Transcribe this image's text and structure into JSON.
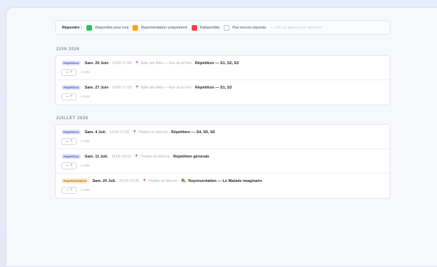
{
  "legend": {
    "label": "Répondre :",
    "items": [
      {
        "label": "Disponible pour tout",
        "color": "#22c55e"
      },
      {
        "label": "Représentation uniquement",
        "color": "#f5a70a"
      },
      {
        "label": "Indisponible",
        "color": "#ef4444"
      },
      {
        "label": "Pas encore répondu",
        "color": "#ffffff"
      }
    ],
    "hint": "— Clic ou glisse pour répondre"
  },
  "months": [
    {
      "title": "JUIN 2026",
      "events": [
        {
          "tag": "Répétition",
          "date": "Sam. 20 Juin",
          "time": "14:00–17:00",
          "place": "Salle des fêtes — Rue de la Paix",
          "title": "Répétition — S1, S2, S3",
          "answer": "— ?",
          "note": "+ note"
        },
        {
          "tag": "Répétition",
          "date": "Sam. 27 Juin",
          "time": "14:00–17:00",
          "place": "Salle des fêtes — Rue de la Paix",
          "title": "Répétition — S1, S3",
          "answer": "— ?",
          "note": "+ note"
        }
      ]
    },
    {
      "title": "JUILLET 2026",
      "events": [
        {
          "tag": "Répétition",
          "date": "Sam. 4 Juil.",
          "time": "14:00–17:00",
          "place": "Théâtre du Marché",
          "title": "Répétition — S4, S5, S6",
          "answer": "— ?",
          "note": "+ note"
        },
        {
          "tag": "Répétition",
          "date": "Sam. 11 Juil.",
          "time": "14:00–18:00",
          "place": "Théâtre du Marché",
          "title": "Répétition générale",
          "answer": "— ?",
          "note": "+ note"
        },
        {
          "tag": "Représentation",
          "date": "Sam. 25 Juil.",
          "time": "20:00–22:30",
          "place": "Théâtre du Marché",
          "title": "Représentation — Le Malade imaginaire",
          "answer": "— ?",
          "note": "+ note"
        }
      ]
    }
  ]
}
